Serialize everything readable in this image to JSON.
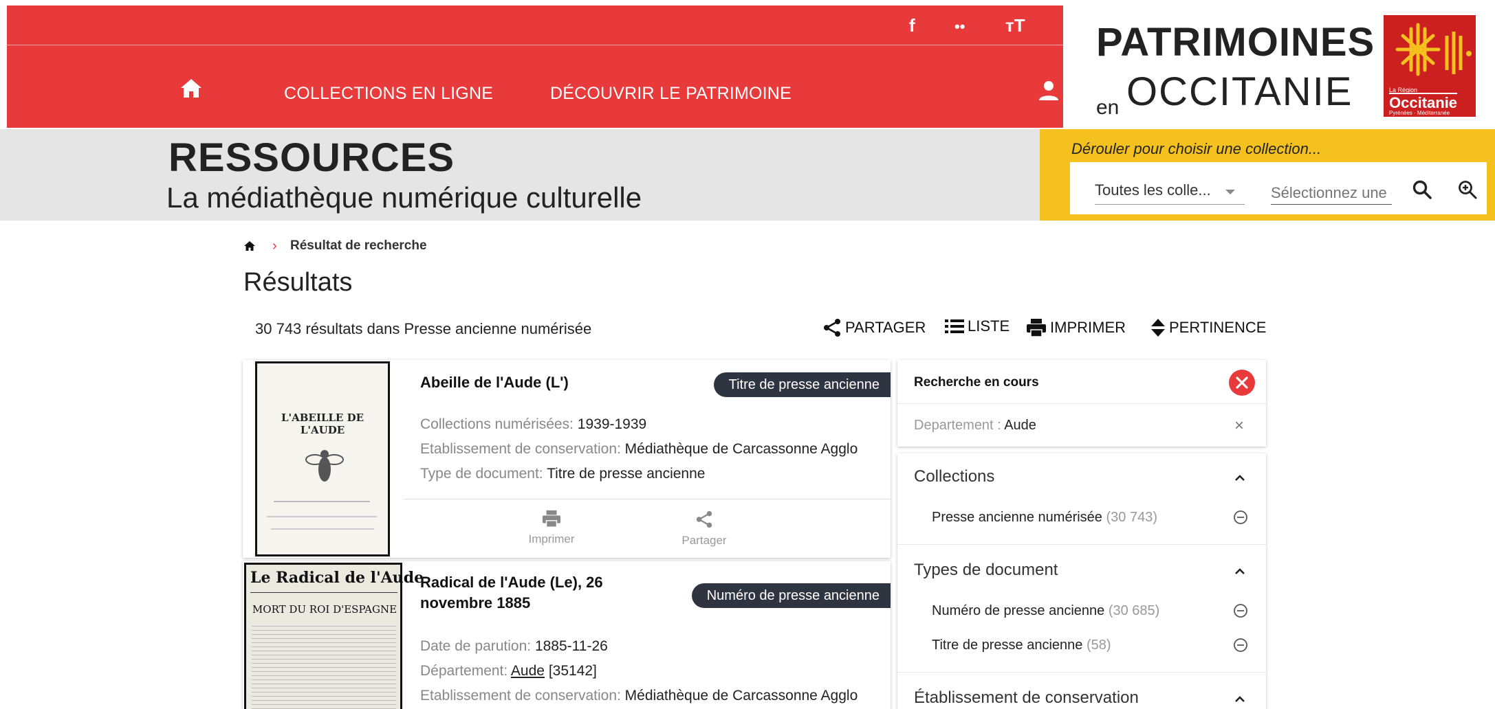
{
  "header": {
    "social": {
      "facebook": "f",
      "flickr": "••",
      "text_size": "тT"
    },
    "nav": {
      "collections": "COLLECTIONS EN LIGNE",
      "decouvrir": "DÉCOUVRIR LE PATRIMOINE"
    }
  },
  "logo": {
    "title": "PATRIMOINES",
    "en": "en",
    "occitanie": "OCCITANIE",
    "region_small": "La Région",
    "region_name": "Occitanie",
    "region_sub": "Pyrénées · Méditerranée"
  },
  "banner": {
    "title": "RESSOURCES",
    "subtitle": "La médiathèque numérique culturelle"
  },
  "search": {
    "hint": "Dérouler pour choisir une collection...",
    "collection_selected": "Toutes les colle...",
    "query_placeholder": "Sélectionnez une c"
  },
  "breadcrumb": {
    "current": "Résultat de recherche"
  },
  "results": {
    "title": "Résultats",
    "count_text": "30 743 résultats dans Presse ancienne numérisée",
    "tools": {
      "share": "PARTAGER",
      "list": "LISTE",
      "print": "IMPRIMER",
      "sort": "PERTINENCE"
    }
  },
  "cards": [
    {
      "title": "Abeille de l'Aude (L')",
      "badge": "Titre de presse ancienne",
      "thumb_text": "L'ABEILLE DE L'AUDE",
      "meta": [
        {
          "label": "Collections numérisées:",
          "value": "1939-1939"
        },
        {
          "label": "Etablissement de conservation:",
          "value": "Médiathèque de Carcassonne Agglo"
        },
        {
          "label": "Type de document:",
          "value": "Titre de presse ancienne"
        }
      ],
      "actions": {
        "print": "Imprimer",
        "share": "Partager"
      }
    },
    {
      "title_line1": "Radical de l'Aude (Le), 26",
      "title_line2": "novembre 1885",
      "badge": "Numéro de presse ancienne",
      "thumb_title": "Le Radical de l'Aude",
      "thumb_headline": "MORT DU ROI D'ESPAGNE",
      "meta": [
        {
          "label": "Date de parution:",
          "value": "1885-11-26"
        },
        {
          "label": "Département:",
          "link": "Aude",
          "value": "[35142]"
        },
        {
          "label": "Etablissement de conservation:",
          "value": "Médiathèque de Carcassonne Agglo"
        }
      ]
    }
  ],
  "current_search": {
    "title": "Recherche en cours",
    "filter_label": "Departement :",
    "filter_value": "Aude",
    "remove": "×"
  },
  "facets": [
    {
      "title": "Collections",
      "items": [
        {
          "label": "Presse ancienne numérisée",
          "count": "(30 743)"
        }
      ]
    },
    {
      "title": "Types de document",
      "items": [
        {
          "label": "Numéro de presse ancienne",
          "count": "(30 685)"
        },
        {
          "label": "Titre de presse ancienne",
          "count": "(58)"
        }
      ]
    },
    {
      "title": "Établissement de conservation",
      "items": []
    }
  ],
  "colors": {
    "brand_red": "#e8393b",
    "banner_grey": "#e5e5e5",
    "search_yellow": "#f5c11f",
    "badge_dark": "#2f3540",
    "region_red": "#cc1f1f"
  }
}
